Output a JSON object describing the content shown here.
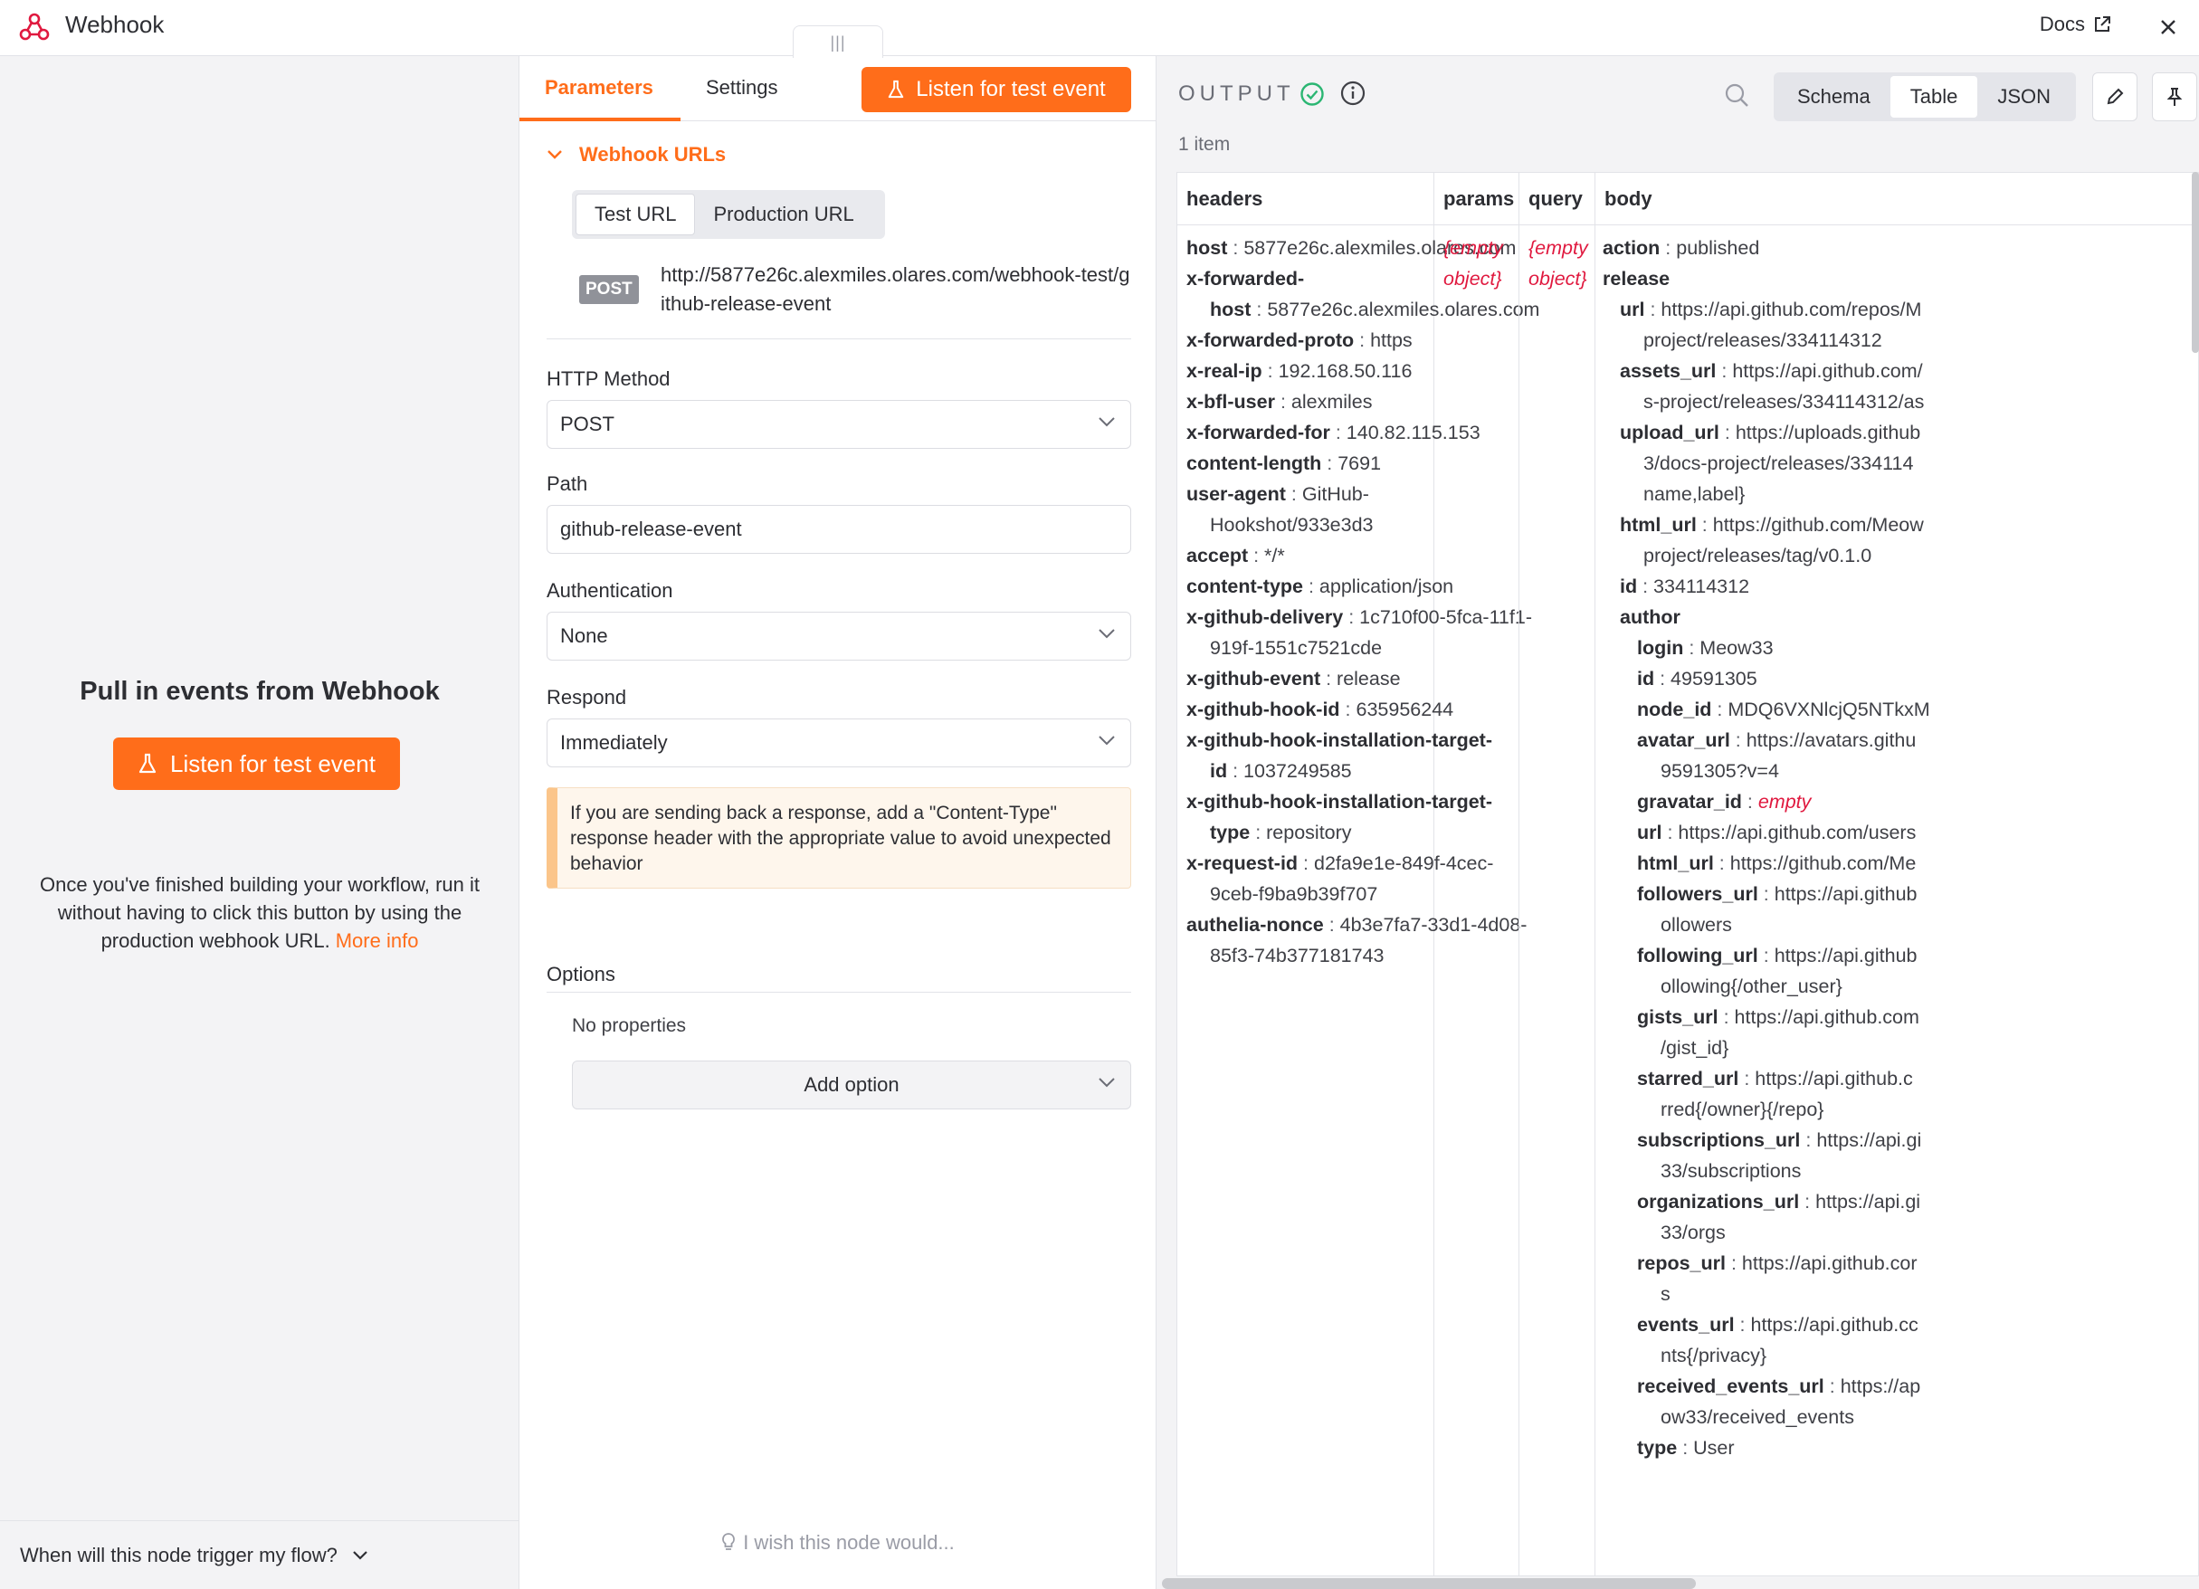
{
  "app": {
    "title": "Webhook",
    "docs_label": "Docs"
  },
  "left": {
    "title": "Pull in events from Webhook",
    "listen_label": "Listen for test event",
    "hint": "Once you've finished building your workflow, run it without having to click this button by using the production webhook URL.",
    "more_info": "More info",
    "trigger_question": "When will this node trigger my flow?"
  },
  "params": {
    "tabs": [
      "Parameters",
      "Settings"
    ],
    "listen_label": "Listen for test event",
    "webhook_urls_label": "Webhook URLs",
    "url_options": [
      "Test URL",
      "Production URL"
    ],
    "method_badge": "POST",
    "url": "http://5877e26c.alexmiles.olares.com/webhook-test/github-release-event",
    "http_method_label": "HTTP Method",
    "http_method_value": "POST",
    "path_label": "Path",
    "path_value": "github-release-event",
    "auth_label": "Authentication",
    "auth_value": "None",
    "respond_label": "Respond",
    "respond_value": "Immediately",
    "notice": "If you are sending back a response, add a \"Content-Type\" response header with the appropriate value to avoid unexpected behavior",
    "options_label": "Options",
    "no_properties": "No properties",
    "add_option": "Add option",
    "wish": "I wish this node would..."
  },
  "output": {
    "label": "OUTPUT",
    "views": [
      "Schema",
      "Table",
      "JSON"
    ],
    "selected_view": "Table",
    "item_count": "1 item",
    "columns": [
      "headers",
      "params",
      "query",
      "body"
    ],
    "params_value": "{empty object}",
    "query_value": "{empty object}",
    "headers": [
      {
        "k": "host",
        "v": "5877e26c.alexmiles.olares.com"
      },
      {
        "k": "x-forwarded-",
        "k2": "host",
        "v": "5877e26c.alexmiles.olares.com"
      },
      {
        "k": "x-forwarded-proto",
        "v": "https"
      },
      {
        "k": "x-real-ip",
        "v": "192.168.50.116"
      },
      {
        "k": "x-bfl-user",
        "v": "alexmiles"
      },
      {
        "k": "x-forwarded-for",
        "v": "140.82.115.153"
      },
      {
        "k": "content-length",
        "v": "7691"
      },
      {
        "k": "user-agent",
        "v": "GitHub-",
        "v2": "Hookshot/933e3d3"
      },
      {
        "k": "accept",
        "v": "*/*"
      },
      {
        "k": "content-type",
        "v": "application/json"
      },
      {
        "k": "x-github-delivery",
        "v": "1c710f00-5fca-11f1-",
        "v2": "919f-1551c7521cde"
      },
      {
        "k": "x-github-event",
        "v": "release"
      },
      {
        "k": "x-github-hook-id",
        "v": "635956244"
      },
      {
        "k": "x-github-hook-installation-target-",
        "k2": "id",
        "v": "1037249585"
      },
      {
        "k": "x-github-hook-installation-target-",
        "k2": "type",
        "v": "repository"
      },
      {
        "k": "x-request-id",
        "v": "d2fa9e1e-849f-4cec-",
        "v2": "9ceb-f9ba9b39f707"
      },
      {
        "k": "authelia-nonce",
        "v": "4b3e7fa7-33d1-4d08-",
        "v2": "85f3-74b377181743"
      }
    ],
    "body": [
      {
        "indent": 0,
        "k": "action",
        "v": "published"
      },
      {
        "indent": 0,
        "k": "release"
      },
      {
        "indent": 1,
        "k": "url",
        "v": "https://api.github.com/repos/M",
        "v2": "project/releases/334114312"
      },
      {
        "indent": 1,
        "k": "assets_url",
        "v": "https://api.github.com/",
        "v2": "s-project/releases/334114312/as"
      },
      {
        "indent": 1,
        "k": "upload_url",
        "v": "https://uploads.github",
        "v2": "3/docs-project/releases/334114",
        "v3": "name,label}"
      },
      {
        "indent": 1,
        "k": "html_url",
        "v": "https://github.com/Meow",
        "v2": "project/releases/tag/v0.1.0"
      },
      {
        "indent": 1,
        "k": "id",
        "v": "334114312"
      },
      {
        "indent": 1,
        "k": "author"
      },
      {
        "indent": 2,
        "k": "login",
        "v": "Meow33"
      },
      {
        "indent": 2,
        "k": "id",
        "v": "49591305"
      },
      {
        "indent": 2,
        "k": "node_id",
        "v": "MDQ6VXNlcjQ5NTkxM"
      },
      {
        "indent": 2,
        "k": "avatar_url",
        "v": "https://avatars.githu",
        "v2": "9591305?v=4"
      },
      {
        "indent": 2,
        "k": "gravatar_id",
        "empty": "empty"
      },
      {
        "indent": 2,
        "k": "url",
        "v": "https://api.github.com/users"
      },
      {
        "indent": 2,
        "k": "html_url",
        "v": "https://github.com/Me"
      },
      {
        "indent": 2,
        "k": "followers_url",
        "v": "https://api.github",
        "v2": "ollowers"
      },
      {
        "indent": 2,
        "k": "following_url",
        "v": "https://api.github",
        "v2": "ollowing{/other_user}"
      },
      {
        "indent": 2,
        "k": "gists_url",
        "v": "https://api.github.com",
        "v2": "/gist_id}"
      },
      {
        "indent": 2,
        "k": "starred_url",
        "v": "https://api.github.c",
        "v2": "rred{/owner}{/repo}"
      },
      {
        "indent": 2,
        "k": "subscriptions_url",
        "v": "https://api.gi",
        "v2": "33/subscriptions"
      },
      {
        "indent": 2,
        "k": "organizations_url",
        "v": "https://api.gi",
        "v2": "33/orgs"
      },
      {
        "indent": 2,
        "k": "repos_url",
        "v": "https://api.github.cor",
        "v2": "s"
      },
      {
        "indent": 2,
        "k": "events_url",
        "v": "https://api.github.cc",
        "v2": "nts{/privacy}"
      },
      {
        "indent": 2,
        "k": "received_events_url",
        "v": "https://ap",
        "v2": "ow33/received_events"
      },
      {
        "indent": 2,
        "k": "type",
        "v": "User"
      }
    ]
  },
  "colors": {
    "accent": "#ff6d1a",
    "success": "#2bb673",
    "empty": "#e0193f"
  }
}
